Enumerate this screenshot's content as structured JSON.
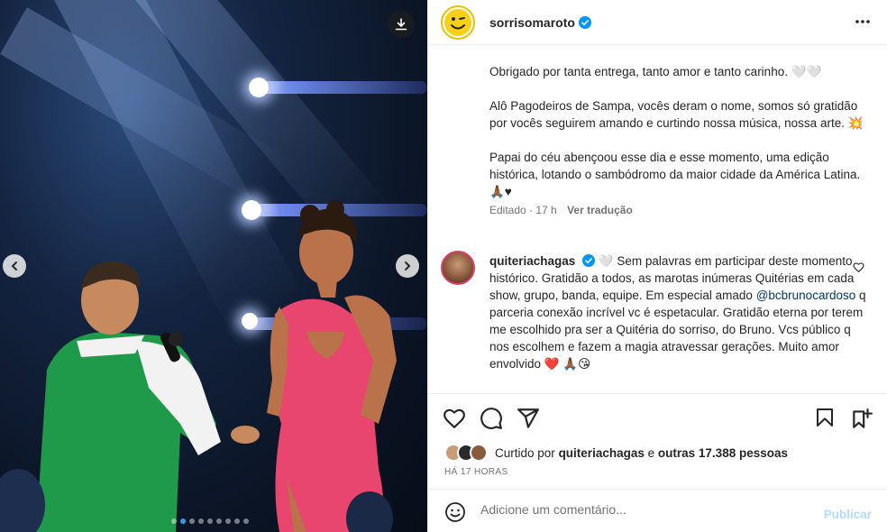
{
  "post": {
    "username": "sorrisomaroto",
    "caption_paragraphs": [
      "Obrigado por tanta entrega, tanto amor e tanto carinho. 🤍🤍",
      "Alô Pagodeiros de Sampa, vocês deram o nome, somos só gratidão por vocês seguirem amando e curtindo nossa música, nossa arte. 💥",
      "Papai do céu abençoou esse dia e esse momento, uma edição histórica, lotando o sambódromo da maior cidade da América Latina. 🙏🏾♥"
    ],
    "edited_label": "Editado",
    "edited_time": "17 h",
    "translate_label": "Ver tradução",
    "likes_prefix": "Curtido por",
    "likes_user": "quiteriachagas",
    "likes_and": "e",
    "likes_others": "outras 17.388 pessoas",
    "time_ago": "HÁ 17 HORAS"
  },
  "comment": {
    "username": "quiteriachagas",
    "text_before_mention": "🤍 Sem palavras em participar deste momento histórico. Gratidão a todos, as marotas inúmeras Quitérias em cada show, grupo, banda, equipe. Em especial amado ",
    "mention": "@bcbrunocardoso",
    "text_after_mention": " q parceria conexão incrível vc é espetacular. Gratidão eterna por terem me escolhido pra ser a Quitéria do sorriso, do Bruno. Vcs público q nos escolhem e fazem a magia atravessar gerações. Muito amor envolvido ❤️ 🙏🏾😘"
  },
  "add_comment": {
    "placeholder": "Adicione um comentário...",
    "post_label": "Publicar"
  },
  "carousel": {
    "total": 9,
    "current": 2
  },
  "icons": [
    "download-icon",
    "chevron-left-icon",
    "chevron-right-icon",
    "more-options-icon",
    "verified-badge-icon",
    "like-icon",
    "comment-icon",
    "share-icon",
    "save-icon",
    "emoji-icon",
    "heart-small-icon"
  ],
  "colors": {
    "verified": "#0095f6",
    "mention": "#00376b",
    "post_disabled": "#b3dbff",
    "muted": "#737373"
  }
}
